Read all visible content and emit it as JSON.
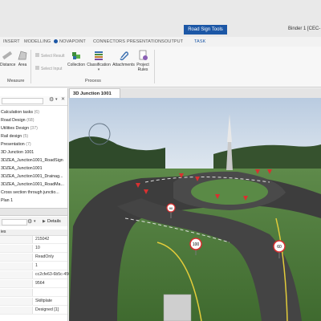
{
  "context_tab": "Road Sign Tools",
  "binder": "Binder 1 [CEC-",
  "ribbon_tabs": [
    "INSERT",
    "MODELLING",
    "NOVAPOINT",
    "CONNECTORS",
    "PRESENTATIONS",
    "OUTPUT",
    "TASK"
  ],
  "ribbon": {
    "distance": "Distance",
    "area": "Area",
    "group_measure": "Measure",
    "select_result": "Select Result",
    "select_input": "Select Input",
    "collection": "Collection",
    "classification": "Classification",
    "attachments": "Attachments",
    "project_rules_1": "Project",
    "project_rules_2": "Rules",
    "group_process": "Process"
  },
  "tree_items": [
    {
      "label": "Calculation tasks",
      "count": "(6)"
    },
    {
      "label": "Road Design",
      "count": "(68)"
    },
    {
      "label": "Utilities Design",
      "count": "(37)"
    },
    {
      "label": "Rail design",
      "count": "(5)"
    },
    {
      "label": "Presentation",
      "count": "(7)"
    },
    {
      "label": "3D Junction 1001",
      "count": ""
    },
    {
      "label": "3DZEA_Junction1001_RoadSign",
      "count": ""
    },
    {
      "label": "3DZEA_Junction1001",
      "count": ""
    },
    {
      "label": "3DZEA_Junction1001_Drainag...",
      "count": ""
    },
    {
      "label": "3DZEA_Junction1001_RoadMa...",
      "count": ""
    },
    {
      "label": "Cross section through junctio...",
      "count": ""
    },
    {
      "label": "Plan 1",
      "count": ""
    }
  ],
  "details_label": "Details",
  "properties_header": "ies",
  "properties": [
    "215042",
    "10",
    "ReadOnly",
    "1",
    "cc2cfe63-6b5c-450b-8df...",
    "9564",
    "",
    "Skiltplate",
    "Designed [1]"
  ],
  "view_tab": "3D Junction 1001",
  "signs": [
    "90",
    "100",
    "60"
  ],
  "icons": {
    "distance": "ruler-icon",
    "area": "area-icon",
    "collection": "collection-icon",
    "classification": "classification-icon",
    "attachments": "paperclip-icon",
    "rules": "rules-icon"
  }
}
